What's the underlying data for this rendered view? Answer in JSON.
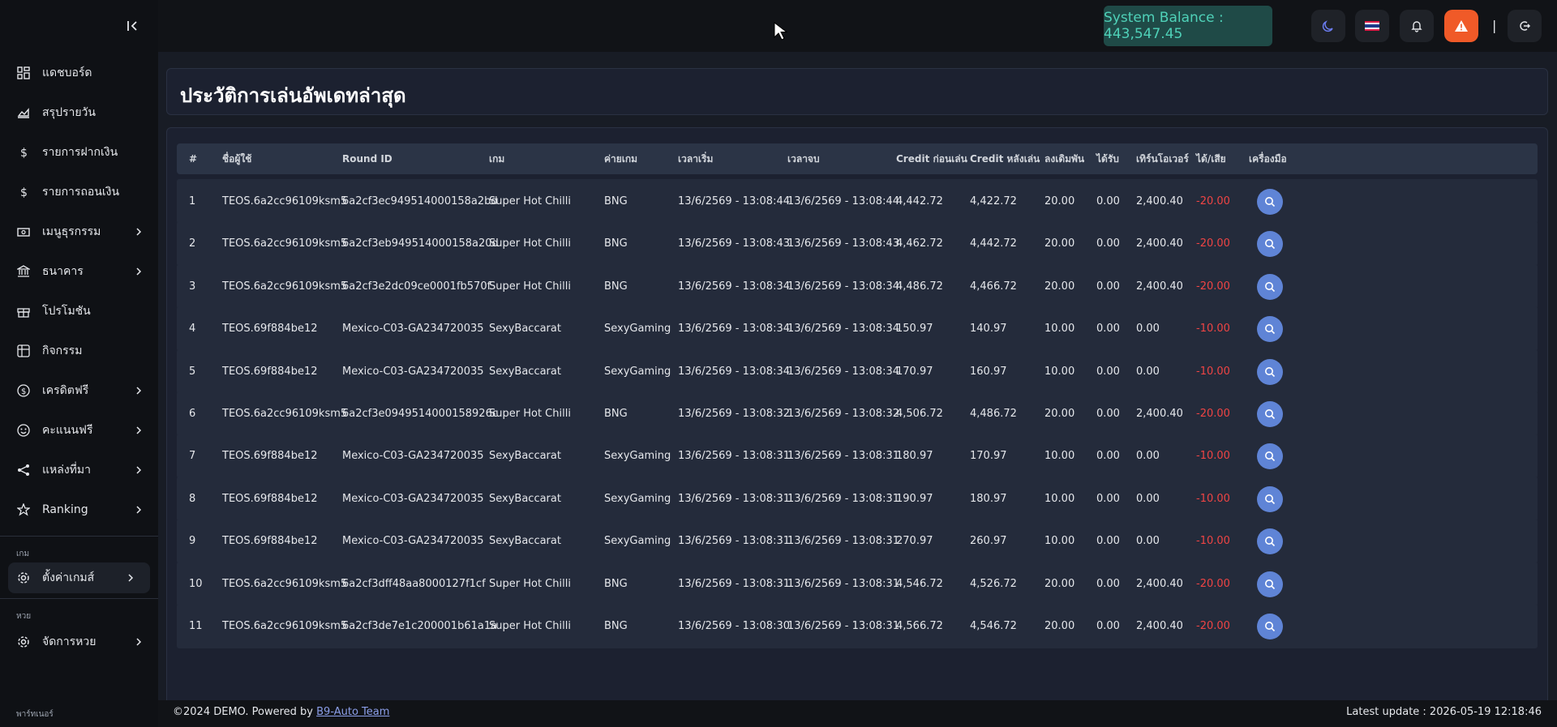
{
  "sidebar": {
    "items": [
      {
        "label": "แดชบอร์ด",
        "icon": "dashboard-icon"
      },
      {
        "label": "สรุปรายวัน",
        "icon": "chart-area-icon"
      },
      {
        "label": "รายการฝากเงิน",
        "icon": "dollar-icon"
      },
      {
        "label": "รายการถอนเงิน",
        "icon": "dollar-icon"
      },
      {
        "label": "เมนูธุรกรรม",
        "icon": "money-icon"
      },
      {
        "label": "ธนาคาร",
        "icon": "bank-icon"
      },
      {
        "label": "โปรโมชัน",
        "icon": "gift-icon"
      },
      {
        "label": "กิจกรรม",
        "icon": "grid-icon"
      },
      {
        "label": "เครดิตฟรี",
        "icon": "coin-icon"
      },
      {
        "label": "คะแนนฟรี",
        "icon": "smile-icon"
      },
      {
        "label": "แหล่งที่มา",
        "icon": "share-icon"
      },
      {
        "label": "Ranking",
        "icon": "star-icon"
      }
    ],
    "section_game": "เกม",
    "game_item": "ตั้งค่าเกมส์",
    "section_lotto": "หวย",
    "lotto_item": "จัดการหวย",
    "section_partner": "พาร์ทเนอร์"
  },
  "topbar": {
    "balance": "System Balance : 443,547.45",
    "separator": "|"
  },
  "page": {
    "title": "ประวัติการเล่นอัพเดทล่าสุด"
  },
  "table": {
    "headers": [
      "#",
      "ชื่อผู้ใช้",
      "Round ID",
      "เกม",
      "ค่ายเกม",
      "เวลาเริ่ม",
      "เวลาจบ",
      "Credit ก่อนเล่น",
      "Credit หลังเล่น",
      "ลงเดิมพัน",
      "ได้รับ",
      "เทิร์นโอเวอร์",
      "ได้/เสีย",
      "เครื่องมือ"
    ],
    "rows": [
      [
        "1",
        "TEOS.6a2cc96109ksm5",
        "6a2cf3ec949514000158a2bd",
        "Super Hot Chilli",
        "BNG",
        "13/6/2569 - 13:08:44",
        "13/6/2569 - 13:08:44",
        "4,442.72",
        "4,422.72",
        "20.00",
        "0.00",
        "2,400.40",
        "-20.00"
      ],
      [
        "2",
        "TEOS.6a2cc96109ksm5",
        "6a2cf3eb949514000158a20d",
        "Super Hot Chilli",
        "BNG",
        "13/6/2569 - 13:08:43",
        "13/6/2569 - 13:08:43",
        "4,462.72",
        "4,442.72",
        "20.00",
        "0.00",
        "2,400.40",
        "-20.00"
      ],
      [
        "3",
        "TEOS.6a2cc96109ksm5",
        "6a2cf3e2dc09ce0001fb570f",
        "Super Hot Chilli",
        "BNG",
        "13/6/2569 - 13:08:34",
        "13/6/2569 - 13:08:34",
        "4,486.72",
        "4,466.72",
        "20.00",
        "0.00",
        "2,400.40",
        "-20.00"
      ],
      [
        "4",
        "TEOS.69f884be12",
        "Mexico-C03-GA234720035",
        "SexyBaccarat",
        "SexyGaming",
        "13/6/2569 - 13:08:34",
        "13/6/2569 - 13:08:34",
        "150.97",
        "140.97",
        "10.00",
        "0.00",
        "0.00",
        "-10.00"
      ],
      [
        "5",
        "TEOS.69f884be12",
        "Mexico-C03-GA234720035",
        "SexyBaccarat",
        "SexyGaming",
        "13/6/2569 - 13:08:34",
        "13/6/2569 - 13:08:34",
        "170.97",
        "160.97",
        "10.00",
        "0.00",
        "0.00",
        "-10.00"
      ],
      [
        "6",
        "TEOS.6a2cc96109ksm5",
        "6a2cf3e0949514000158926c",
        "Super Hot Chilli",
        "BNG",
        "13/6/2569 - 13:08:32",
        "13/6/2569 - 13:08:32",
        "4,506.72",
        "4,486.72",
        "20.00",
        "0.00",
        "2,400.40",
        "-20.00"
      ],
      [
        "7",
        "TEOS.69f884be12",
        "Mexico-C03-GA234720035",
        "SexyBaccarat",
        "SexyGaming",
        "13/6/2569 - 13:08:31",
        "13/6/2569 - 13:08:31",
        "180.97",
        "170.97",
        "10.00",
        "0.00",
        "0.00",
        "-10.00"
      ],
      [
        "8",
        "TEOS.69f884be12",
        "Mexico-C03-GA234720035",
        "SexyBaccarat",
        "SexyGaming",
        "13/6/2569 - 13:08:31",
        "13/6/2569 - 13:08:31",
        "190.97",
        "180.97",
        "10.00",
        "0.00",
        "0.00",
        "-10.00"
      ],
      [
        "9",
        "TEOS.69f884be12",
        "Mexico-C03-GA234720035",
        "SexyBaccarat",
        "SexyGaming",
        "13/6/2569 - 13:08:31",
        "13/6/2569 - 13:08:31",
        "270.97",
        "260.97",
        "10.00",
        "0.00",
        "0.00",
        "-10.00"
      ],
      [
        "10",
        "TEOS.6a2cc96109ksm5",
        "6a2cf3dff48aa8000127f1cf",
        "Super Hot Chilli",
        "BNG",
        "13/6/2569 - 13:08:31",
        "13/6/2569 - 13:08:31",
        "4,546.72",
        "4,526.72",
        "20.00",
        "0.00",
        "2,400.40",
        "-20.00"
      ],
      [
        "11",
        "TEOS.6a2cc96109ksm5",
        "6a2cf3de7e1c200001b61a1a",
        "Super Hot Chilli",
        "BNG",
        "13/6/2569 - 13:08:30",
        "13/6/2569 - 13:08:31",
        "4,566.72",
        "4,546.72",
        "20.00",
        "0.00",
        "2,400.40",
        "-20.00"
      ]
    ]
  },
  "footer": {
    "copyright": "©2024 DEMO. Powered by",
    "link": "B9-Auto Team",
    "latest_update": "Latest update : 2026-05-19 12:18:46"
  },
  "colors": {
    "accent": "#5f84d6",
    "balance_bg": "#1f4a47",
    "balance_text": "#4fd1b8",
    "alert": "#f05a28",
    "loss": "#ef4444"
  }
}
